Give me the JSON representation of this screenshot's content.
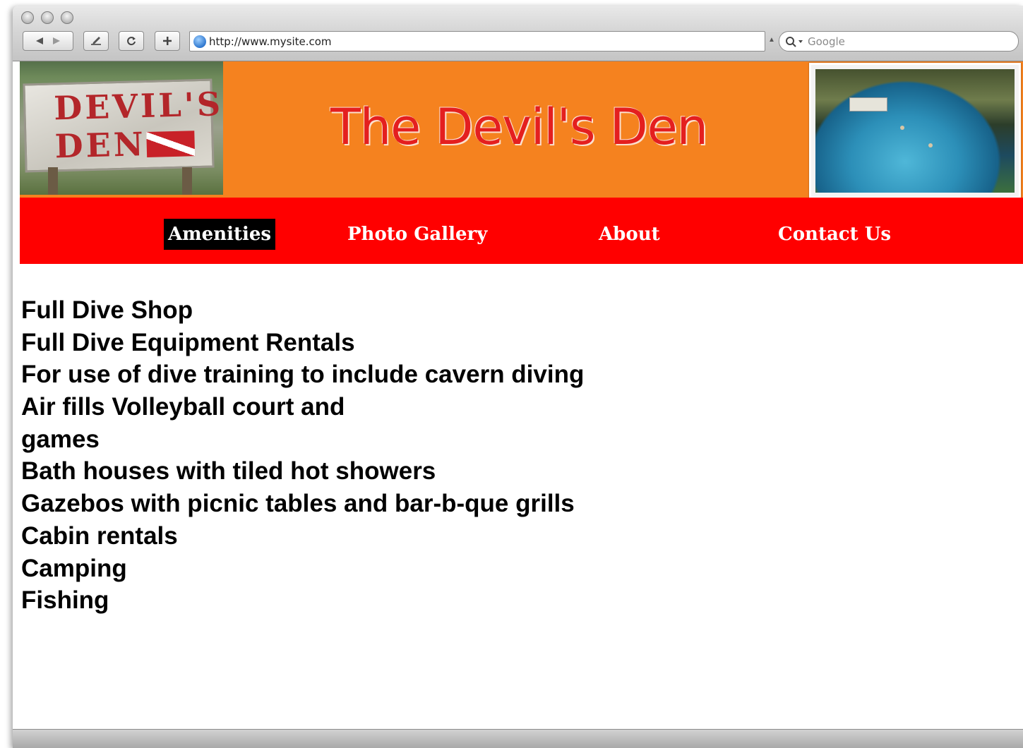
{
  "browser": {
    "url": "http://www.mysite.com",
    "search_placeholder": "Google"
  },
  "header": {
    "logo_line1": "DEVIL'S",
    "logo_line2": "DEN",
    "title": "The Devil's Den"
  },
  "nav": {
    "items": [
      {
        "label": "Amenities"
      },
      {
        "label": "Photo Gallery"
      },
      {
        "label": "About"
      },
      {
        "label": "Contact Us"
      }
    ],
    "active": "Amenities"
  },
  "amenities": [
    "Full Dive Shop",
    "Full Dive Equipment Rentals",
    "For use of dive training to include cavern diving",
    "Air fills Volleyball court and",
    "games",
    "Bath houses with tiled hot showers",
    "Gazebos with picnic tables and bar-b-que grills",
    "Cabin rentals",
    "Camping",
    "Fishing"
  ],
  "colors": {
    "header_bg": "#f5821f",
    "nav_bg": "#ff0000",
    "title_color": "#e41f1f",
    "active_nav_bg": "#000000"
  }
}
